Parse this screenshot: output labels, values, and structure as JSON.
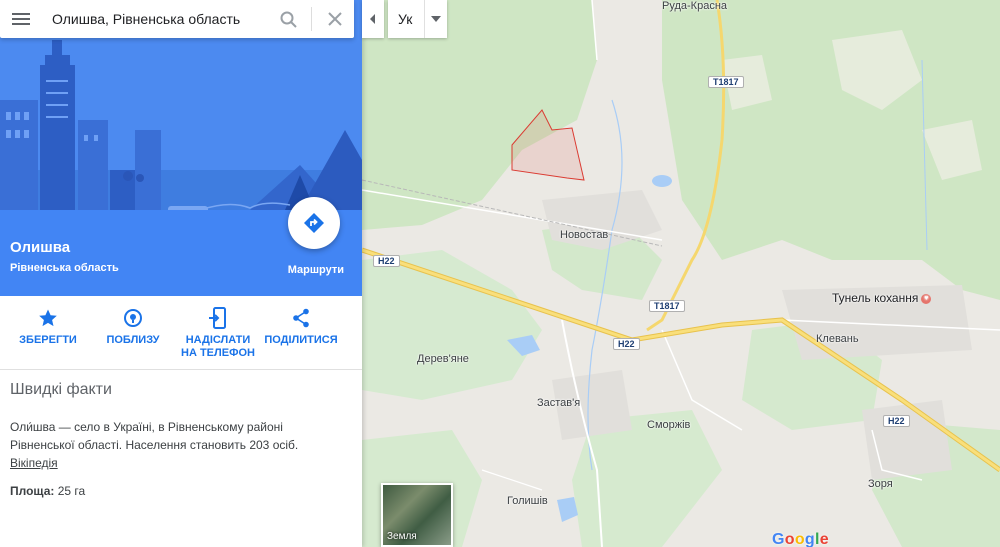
{
  "search": {
    "query": "Олишва, Рівненська область"
  },
  "language": {
    "selected": "Ук"
  },
  "place": {
    "title": "Олишва",
    "subtitle": "Рівненська область",
    "routes_label": "Маршрути"
  },
  "actions": [
    {
      "label": "ЗБЕРЕГТИ"
    },
    {
      "label": "ПОБЛИЗУ"
    },
    {
      "label": "НАДІСЛАТИ НА ТЕЛЕФОН"
    },
    {
      "label": "ПОДІЛИТИСЯ"
    }
  ],
  "quick_facts": {
    "title": "Швидкі факти",
    "description": "Оли́шва — село в Україні, в Рівненському районі Рівненської області. Населення становить 203 осіб.",
    "wiki_link": "Вікіпедія",
    "area_label": "Площа:",
    "area_value": "25 га"
  },
  "map": {
    "labels": {
      "ruda": "Руда-Красна",
      "novostav": "Новостав",
      "tunel": "Тунель кохання",
      "klevan": "Клевань",
      "derevyane": "Дерев'яне",
      "zastavia": "Застав'я",
      "smorzhiv": "Сморжів",
      "holyshiv": "Голишів",
      "zoria": "Зоря"
    },
    "shields": {
      "t1817_top": "T1817",
      "t1817_mid": "T1817",
      "h22_left": "H22",
      "h22_mid": "H22",
      "h22_right": "H22"
    },
    "earth_label": "Земля",
    "logo": [
      "G",
      "o",
      "o",
      "g",
      "l",
      "e"
    ]
  },
  "colors": {
    "accent": "#4285f4",
    "link": "#1a73e8",
    "highway": "#f5d76e",
    "forest": "#cfe6c4",
    "water": "#a9cdf6",
    "boundary": "#db3b32"
  },
  "icons": [
    "menu-icon",
    "search-icon",
    "close-icon",
    "chevron-left-icon",
    "caret-down-icon",
    "directions-icon",
    "star-icon",
    "nearby-pin-icon",
    "send-to-phone-icon",
    "share-icon"
  ]
}
